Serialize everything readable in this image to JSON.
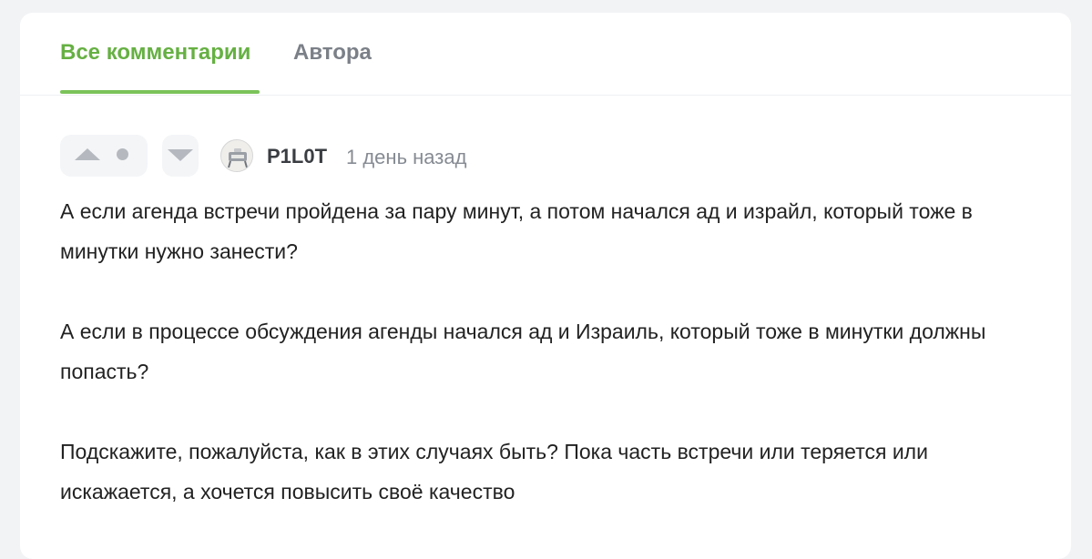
{
  "tabs": {
    "all_comments": "Все комментарии",
    "author": "Автора",
    "active": "all_comments"
  },
  "comment": {
    "score": "●",
    "author": "P1L0T",
    "time": "1 день назад",
    "paragraphs": [
      "А если агенда встречи пройдена за пару минут, а потом начался ад и израйл, который тоже в минутки нужно занести?",
      "А если в процессе обсуждения агенды начался ад и Израиль, который тоже в минутки должны попасть?",
      "Подскажите, пожалуйста, как в этих случаях быть? Пока часть встречи или теряется или искажается, а хочется повысить своё качество"
    ]
  },
  "icons": {
    "upvote": "arrow-up-icon",
    "downvote": "arrow-down-icon",
    "score_dot": "dot-icon",
    "avatar": "user-avatar"
  },
  "colors": {
    "accent": "#66b043",
    "accent_underline": "#7bc35a",
    "inactive_tab": "#7b8088",
    "muted": "#868b93",
    "vote_icon": "#b5b9bf"
  }
}
